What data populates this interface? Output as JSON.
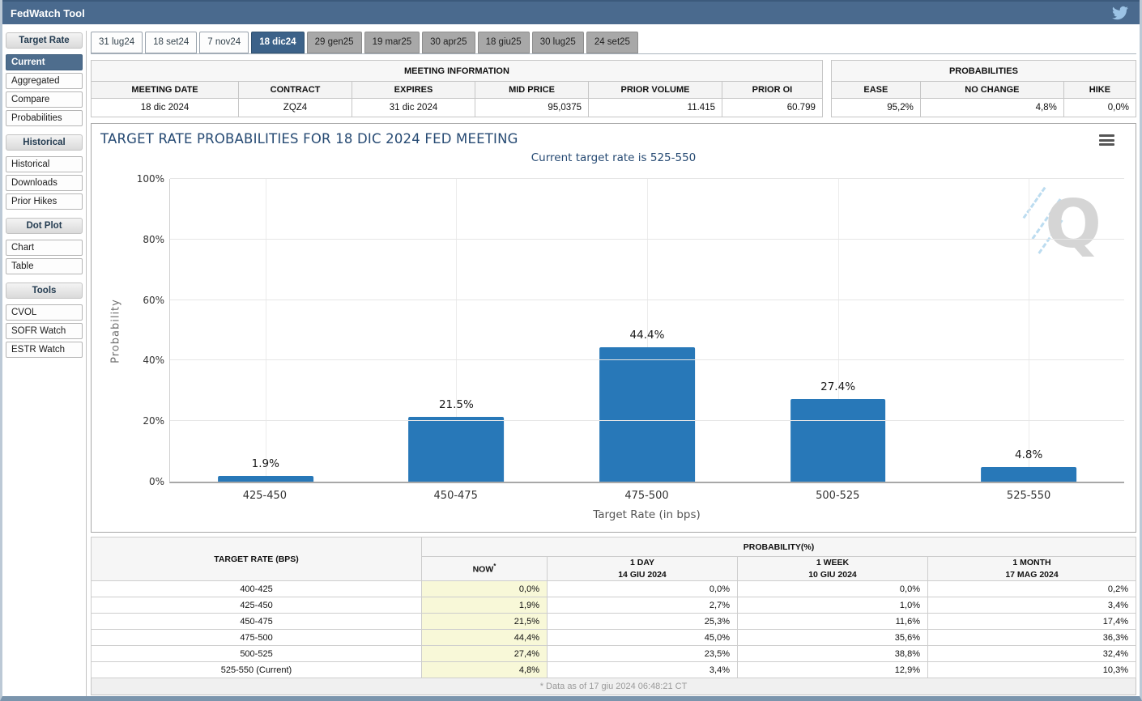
{
  "header": {
    "title": "FedWatch Tool",
    "twitter_icon": "twitter-bird"
  },
  "tabs": [
    {
      "label": "31 lug24",
      "state": "light"
    },
    {
      "label": "18 set24",
      "state": "light"
    },
    {
      "label": "7 nov24",
      "state": "light"
    },
    {
      "label": "18 dic24",
      "state": "selected"
    },
    {
      "label": "29 gen25",
      "state": "gray"
    },
    {
      "label": "19 mar25",
      "state": "gray"
    },
    {
      "label": "30 apr25",
      "state": "gray"
    },
    {
      "label": "18 giu25",
      "state": "gray"
    },
    {
      "label": "30 lug25",
      "state": "gray"
    },
    {
      "label": "24 set25",
      "state": "gray"
    }
  ],
  "sidebar": {
    "sections": [
      {
        "header": "Target Rate",
        "items": [
          {
            "label": "Current",
            "state": "selected"
          },
          {
            "label": "Aggregated",
            "state": ""
          },
          {
            "label": "Compare",
            "state": ""
          },
          {
            "label": "Probabilities",
            "state": ""
          }
        ]
      },
      {
        "header": "Historical",
        "items": [
          {
            "label": "Historical",
            "state": ""
          },
          {
            "label": "Downloads",
            "state": ""
          },
          {
            "label": "Prior Hikes",
            "state": ""
          }
        ]
      },
      {
        "header": "Dot Plot",
        "items": [
          {
            "label": "Chart",
            "state": ""
          },
          {
            "label": "Table",
            "state": ""
          }
        ]
      },
      {
        "header": "Tools",
        "items": [
          {
            "label": "CVOL",
            "state": ""
          },
          {
            "label": "SOFR Watch",
            "state": ""
          },
          {
            "label": "ESTR Watch",
            "state": ""
          }
        ]
      }
    ]
  },
  "meeting_info": {
    "title": "MEETING INFORMATION",
    "columns": [
      "MEETING DATE",
      "CONTRACT",
      "EXPIRES",
      "MID PRICE",
      "PRIOR VOLUME",
      "PRIOR OI"
    ],
    "values": [
      "18 dic 2024",
      "ZQZ4",
      "31 dic 2024",
      "95,0375",
      "11.415",
      "60.799"
    ]
  },
  "probabilities_summary": {
    "title": "PROBABILITIES",
    "columns": [
      "EASE",
      "NO CHANGE",
      "HIKE"
    ],
    "values": [
      "95,2%",
      "4,8%",
      "0,0%"
    ]
  },
  "chart_data": {
    "type": "bar",
    "title": "TARGET RATE PROBABILITIES FOR 18 DIC 2024 FED MEETING",
    "subtitle": "Current target rate is 525-550",
    "categories": [
      "425-450",
      "450-475",
      "475-500",
      "500-525",
      "525-550"
    ],
    "values": [
      1.9,
      21.5,
      44.4,
      27.4,
      4.8
    ],
    "value_labels": [
      "1.9%",
      "21.5%",
      "44.4%",
      "27.4%",
      "4.8%"
    ],
    "xlabel": "Target Rate (in bps)",
    "ylabel": "Probability",
    "ylim": [
      0,
      100
    ],
    "yticks": [
      0,
      20,
      40,
      60,
      80,
      100
    ],
    "ytick_labels": [
      "0%",
      "20%",
      "40%",
      "60%",
      "80%",
      "100%"
    ],
    "bar_color": "#2878b8",
    "grid": true,
    "legend": "none",
    "watermark": "Q"
  },
  "probability_table": {
    "col1_header": "TARGET RATE (BPS)",
    "group_header": "PROBABILITY(%)",
    "columns": [
      {
        "label": "NOW",
        "note": "*",
        "sub": ""
      },
      {
        "label": "1 DAY",
        "sub": "14 GIU 2024"
      },
      {
        "label": "1 WEEK",
        "sub": "10 GIU 2024"
      },
      {
        "label": "1 MONTH",
        "sub": "17 MAG 2024"
      }
    ],
    "rows": [
      {
        "rate": "400-425",
        "now": "0,0%",
        "day": "0,0%",
        "week": "0,0%",
        "month": "0,2%"
      },
      {
        "rate": "425-450",
        "now": "1,9%",
        "day": "2,7%",
        "week": "1,0%",
        "month": "3,4%"
      },
      {
        "rate": "450-475",
        "now": "21,5%",
        "day": "25,3%",
        "week": "11,6%",
        "month": "17,4%"
      },
      {
        "rate": "475-500",
        "now": "44,4%",
        "day": "45,0%",
        "week": "35,6%",
        "month": "36,3%"
      },
      {
        "rate": "500-525",
        "now": "27,4%",
        "day": "23,5%",
        "week": "38,8%",
        "month": "32,4%"
      },
      {
        "rate": "525-550 (Current)",
        "now": "4,8%",
        "day": "3,4%",
        "week": "12,9%",
        "month": "10,3%"
      }
    ]
  },
  "footer": {
    "note": "* Data as of 17 giu 2024 06:48:21 CT"
  },
  "colors": {
    "titlebar": "#4a6a8e",
    "selected_tab": "#3c6289",
    "bar": "#2878b8",
    "now_column": "#f8f8d8",
    "chart_title": "#264a73"
  }
}
